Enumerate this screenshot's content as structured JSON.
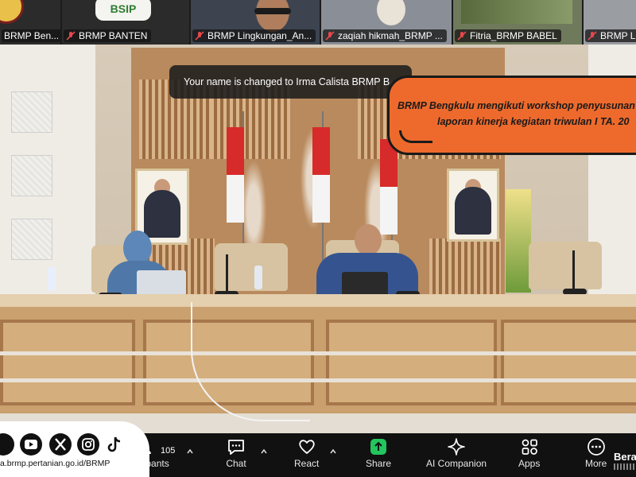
{
  "participants": [
    {
      "name": "BRMP Ben..."
    },
    {
      "name": "BRMP BANTEN"
    },
    {
      "name": "BRMP Lingkungan_An..."
    },
    {
      "name": "zaqiah hikmah_BRMP ..."
    },
    {
      "name": "Fitria_BRMP BABEL"
    },
    {
      "name": "BRMP L"
    }
  ],
  "thumb_logo_text": "BSIP",
  "toast": {
    "text": "Your name is changed to Irma Calista BRMP B"
  },
  "banner": {
    "line1": "BRMP Bengkulu mengikuti workshop penyusunan",
    "line2": "laporan kinerja kegiatan triwulan I TA. 20"
  },
  "toolbar": {
    "participants": {
      "label": "Participants",
      "count": "105"
    },
    "chat": {
      "label": "Chat"
    },
    "react": {
      "label": "React"
    },
    "share": {
      "label": "Share"
    },
    "ai_companion": {
      "label": "AI Companion"
    },
    "apps": {
      "label": "Apps"
    },
    "more": {
      "label": "More"
    },
    "brand": "Bera"
  },
  "social": {
    "url": "a.brmp.pertanian.go.id/BRMP"
  },
  "colors": {
    "banner": "#ee6a2c",
    "share_green": "#23c55e",
    "toolbar_bg": "#111111"
  }
}
